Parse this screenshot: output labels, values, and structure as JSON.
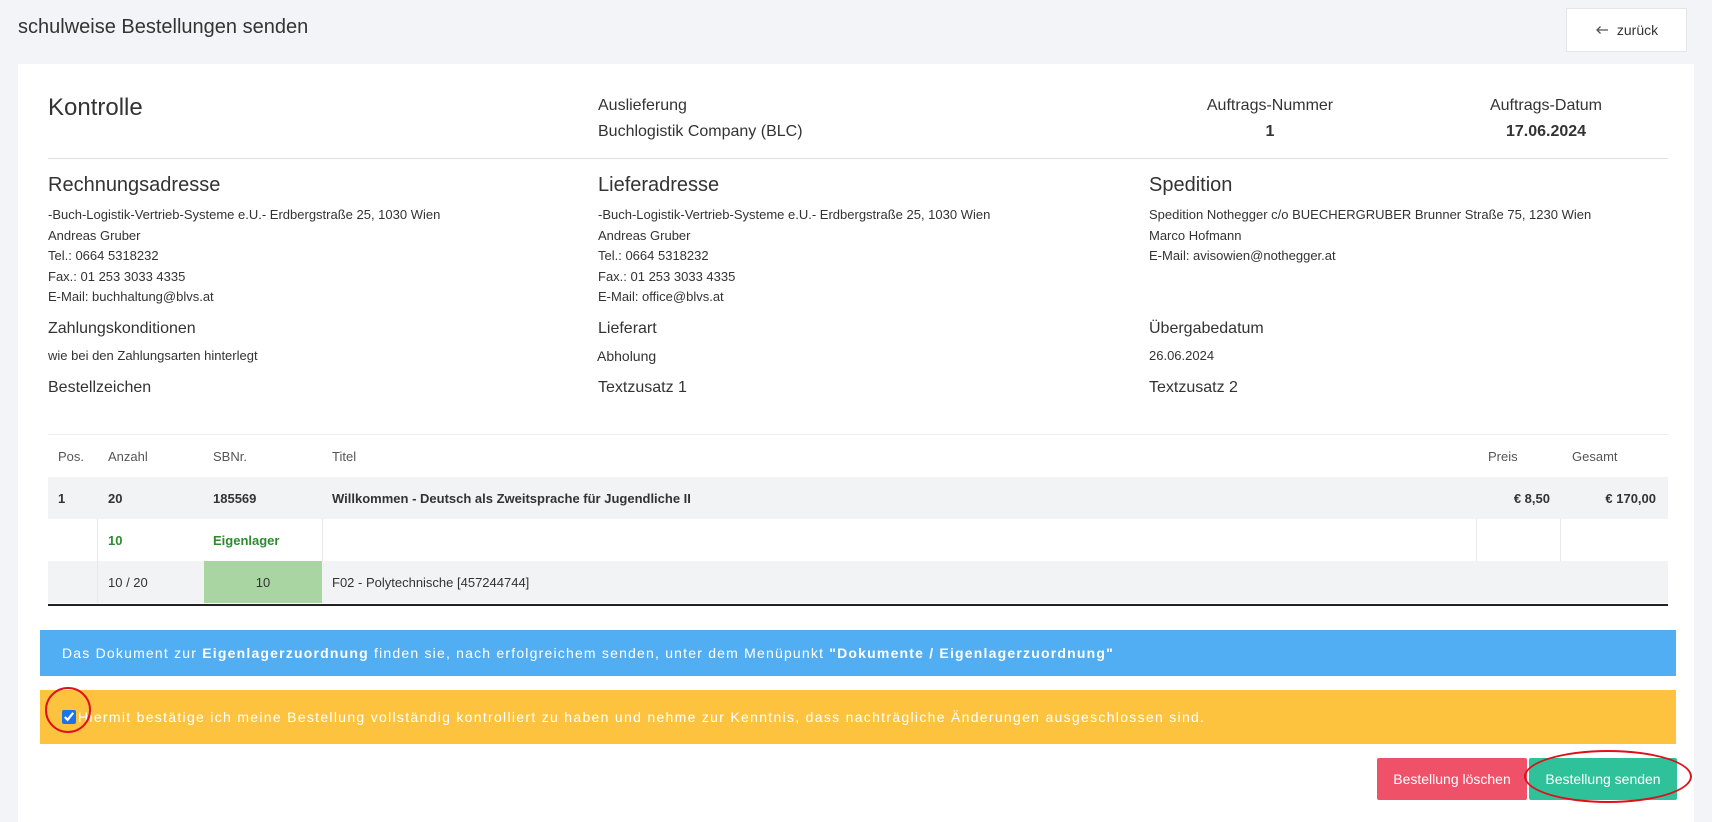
{
  "page": {
    "title": "schulweise Bestellungen senden",
    "back_label": "zurück"
  },
  "kontrolle": {
    "heading": "Kontrolle"
  },
  "auslieferung": {
    "label": "Auslieferung",
    "value": "Buchlogistik Company (BLC)"
  },
  "auftrag": {
    "nummer_label": "Auftrags-Nummer",
    "nummer_value": "1",
    "datum_label": "Auftrags-Datum",
    "datum_value": "17.06.2024"
  },
  "rechnungsadresse": {
    "heading": "Rechnungsadresse",
    "lines": [
      "-Buch-Logistik-Vertrieb-Systeme e.U.- Erdbergstraße 25, 1030 Wien",
      "Andreas Gruber",
      "Tel.: 0664 5318232",
      "Fax.: 01 253 3033 4335",
      "E-Mail: buchhaltung@blvs.at"
    ]
  },
  "lieferadresse": {
    "heading": "Lieferadresse",
    "lines": [
      "-Buch-Logistik-Vertrieb-Systeme e.U.- Erdbergstraße 25, 1030 Wien",
      "Andreas Gruber",
      "Tel.: 0664 5318232",
      "Fax.: 01 253 3033 4335",
      "E-Mail: office@blvs.at"
    ]
  },
  "spedition": {
    "heading": "Spedition",
    "lines": [
      "Spedition Nothegger c/o BUECHERGRUBER Brunner Straße 75, 1230 Wien",
      "Marco Hofmann",
      "E-Mail: avisowien@nothegger.at"
    ]
  },
  "zahlungskonditionen": {
    "label": "Zahlungskonditionen",
    "value": "wie bei den Zahlungsarten hinterlegt"
  },
  "lieferart": {
    "label": "Lieferart",
    "value": "Abholung"
  },
  "uebergabedatum": {
    "label": "Übergabedatum",
    "value": "26.06.2024"
  },
  "bestellzeichen": {
    "label": "Bestellzeichen"
  },
  "textzusatz1": {
    "label": "Textzusatz 1"
  },
  "textzusatz2": {
    "label": "Textzusatz 2"
  },
  "table": {
    "headers": {
      "pos": "Pos.",
      "anzahl": "Anzahl",
      "sbnr": "SBNr.",
      "titel": "Titel",
      "preis": "Preis",
      "gesamt": "Gesamt"
    },
    "row": {
      "pos": "1",
      "anzahl": "20",
      "sbnr": "185569",
      "titel": "Willkommen - Deutsch als Zweitsprache für Jugendliche II",
      "preis": "€ 8,50",
      "gesamt": "€ 170,00"
    },
    "eigenlager": {
      "anzahl": "10",
      "label": "Eigenlager"
    },
    "schule": {
      "ratio": "10 / 20",
      "menge": "10",
      "name": "F02 - Polytechnische [457244744]"
    }
  },
  "info": {
    "part1": "Das Dokument zur ",
    "bold1": "Eigenlagerzuordnung",
    "part2": " finden sie, nach erfolgreichem senden, unter dem Menüpunkt ",
    "bold2": "\"Dokumente / Eigenlagerzuordnung\""
  },
  "confirm": {
    "text": "Hiermit bestätige ich meine Bestellung vollständig kontrolliert zu haben und nehme zur Kenntnis, dass nachträgliche Änderungen ausgeschlossen sind.",
    "checked": true
  },
  "buttons": {
    "delete": "Bestellung löschen",
    "send": "Bestellung senden"
  },
  "colors": {
    "info_bg": "#52aef2",
    "warn_bg": "#fdc33e",
    "delete_bg": "#ee5168",
    "send_bg": "#2ec19a",
    "annotation_circle": "#e0101a"
  }
}
